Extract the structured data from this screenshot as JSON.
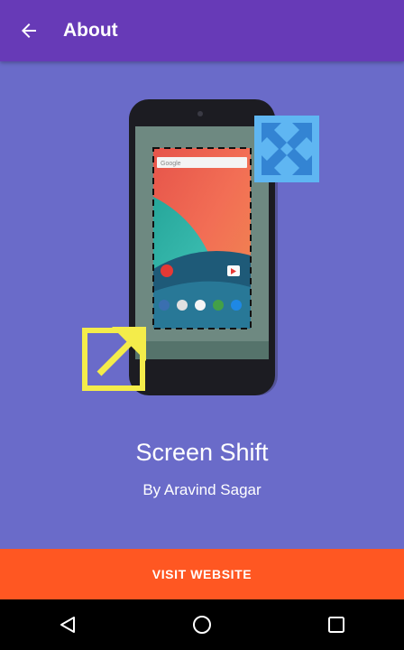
{
  "app_bar": {
    "title": "About",
    "back_icon": "arrow-back-icon"
  },
  "about": {
    "app_name": "Screen Shift",
    "author": "By Aravind Sagar",
    "visit_button": "VISIT WEBSITE"
  },
  "phone_screen": {
    "search_text": "Google"
  },
  "colors": {
    "app_bar": "#673ab7",
    "background": "#6a6bc9",
    "button": "#ff5722",
    "expand_icon": "#4fb0f0",
    "shift_icon": "#f4ec4a"
  },
  "nav_bar": {
    "icons": [
      "back-triangle-icon",
      "home-circle-icon",
      "recents-square-icon"
    ]
  }
}
